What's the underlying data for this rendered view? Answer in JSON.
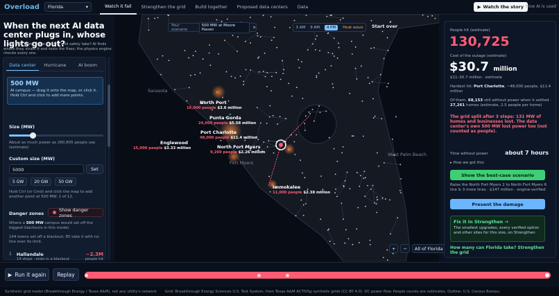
{
  "topbar": {
    "brand": "Overload",
    "state_value": "Florida",
    "tabs": [
      {
        "label": "Watch it fail",
        "active": true
      },
      {
        "label": "Strengthen the grid",
        "active": false
      },
      {
        "label": "Build together",
        "active": false
      },
      {
        "label": "Proposed data centers",
        "active": false
      },
      {
        "label": "Data",
        "active": false
      }
    ],
    "watch_story": "Watch the story",
    "how_ai_used": "How AI is used"
  },
  "left": {
    "headline": "When the next AI data center plugs in, whose lights go out?",
    "lede": "…and how many more can the grid safely take? AI finds where they strain it and tests the fixes; the physics engine checks every one.",
    "tabs": [
      {
        "label": "Data center",
        "active": true
      },
      {
        "label": "Hurricane",
        "active": false
      },
      {
        "label": "AI boom",
        "active": false
      }
    ],
    "mw_box": {
      "value": "500 MW",
      "desc": "AI campus — drag it onto the map, or click it. Hold Ctrl and click to add more points."
    },
    "size_label": "Size (MW)",
    "size_fraction": 0.25,
    "size_note": "About as much power as 260,805 people use (estimate)",
    "custom_label": "Custom size (MW)",
    "custom_value": "5000",
    "set_label": "Set",
    "chips": [
      "5 GW",
      "20 GW",
      "50 GW"
    ],
    "ctrl_note": "Hold Ctrl (or Cmd) and click the map to add another point at 500 MW. 1 of 12.",
    "danger_label": "Danger zones",
    "danger_button": "Show danger zones",
    "where_prefix": "Where a ",
    "where_bold": "500 MW",
    "where_suffix": " campus would set off the biggest blackouts in this model.",
    "towns_note": "144 towns set off a blackout; 85 take it with no line over its limit.",
    "top_town": {
      "rank": "1",
      "name": "Hallandale",
      "sub": "14 steps · ends in a blackout",
      "delta": "−2.3M",
      "unit": "people hit"
    }
  },
  "map": {
    "scenario_label": "Your scenario",
    "scenario_value": "500 MW at Moore Haven",
    "scenario_close": "×",
    "times": [
      {
        "label": "3 AM",
        "active": false
      },
      {
        "label": "9 AM",
        "active": false
      },
      {
        "label": "4 PM",
        "active": true
      },
      {
        "label": "Heat wave",
        "active": false,
        "accent": true
      }
    ],
    "start_over": "Start over",
    "zoom_plus": "+",
    "zoom_minus": "−",
    "all_label": "All of Florida",
    "cities": [
      {
        "name": "North Port",
        "people": "16,000 people",
        "dollars": "$3.6 million"
      },
      {
        "name": "Punta Gorda",
        "people": "24,000 people",
        "dollars": "$5.58 million"
      },
      {
        "name": "Port Charlotte",
        "people": "48,000 people",
        "dollars": "$11.4 million"
      },
      {
        "name": "Englewood",
        "people": "15,000 people",
        "dollars": "$3.33 million"
      },
      {
        "name": "North Fort Myers",
        "people": "9,200 people",
        "dollars": "$2.26 million"
      },
      {
        "name": "Immokalee",
        "people": "11,000 people",
        "dollars": "$2.38 million"
      }
    ],
    "places": [
      "Sarasota",
      "Fort Myers",
      "West Palm Beach"
    ]
  },
  "right": {
    "people_hit_label": "People hit (estimate)",
    "people_hit": "130,725",
    "cost_label": "Cost of the outage (estimate)",
    "cost_value": "$30.7",
    "cost_unit": "million",
    "cost_range": "$11–30.7 million · estimate",
    "hardest_prefix": "Hardest hit: ",
    "hardest_name": "Port Charlotte",
    "hardest_suffix": ", ~48,000 people, $11.4 million",
    "still_prefix": "Of them, ",
    "still_a": "68,153",
    "still_mid": " still without power when it settled · ",
    "still_b": "27,261",
    "still_suffix": " homes (estimate, 2.5 people per home)",
    "red_summary": "The grid split after 3 steps: 131 MW of homes and businesses lost. The data center's own 500 MW lost power too (not counted as people).",
    "time_label": "Time without power",
    "time_value": "about 7 hours",
    "how_got": "How we got this",
    "best_case": "Show the best-case scenario",
    "raise_note": "Raise the North Fort Myers 2 to North Fort Myers 6 line & 3 more lines · $147 million · engine-verified",
    "present_damage": "Present the damage",
    "fix_title": "Fix it in Strengthen →",
    "fix_body": "The smallest upgrades, every verified option and other sites for this size, on Strengthen",
    "how_many": "How many can Florida take? Strengthen the grid"
  },
  "bottom": {
    "run_again": "Run it again",
    "replay": "Replay",
    "progress": 1.0
  },
  "footer": {
    "left": "Synthetic grid model (Breakthrough Energy / Texas A&M), not any utility's network",
    "right": "Grid: Breakthrough Energy Sciences U.S. Test System, from Texas A&M ACTIVSg synthetic grids (CC-BY 4.0). DC power flow. People counts are estimates. Outline: U.S. Census Bureau."
  },
  "colors": {
    "accent_blue": "#7cc3ff",
    "danger_red": "#ff5c74",
    "green": "#3ecf75",
    "bg": "#0b1220"
  }
}
